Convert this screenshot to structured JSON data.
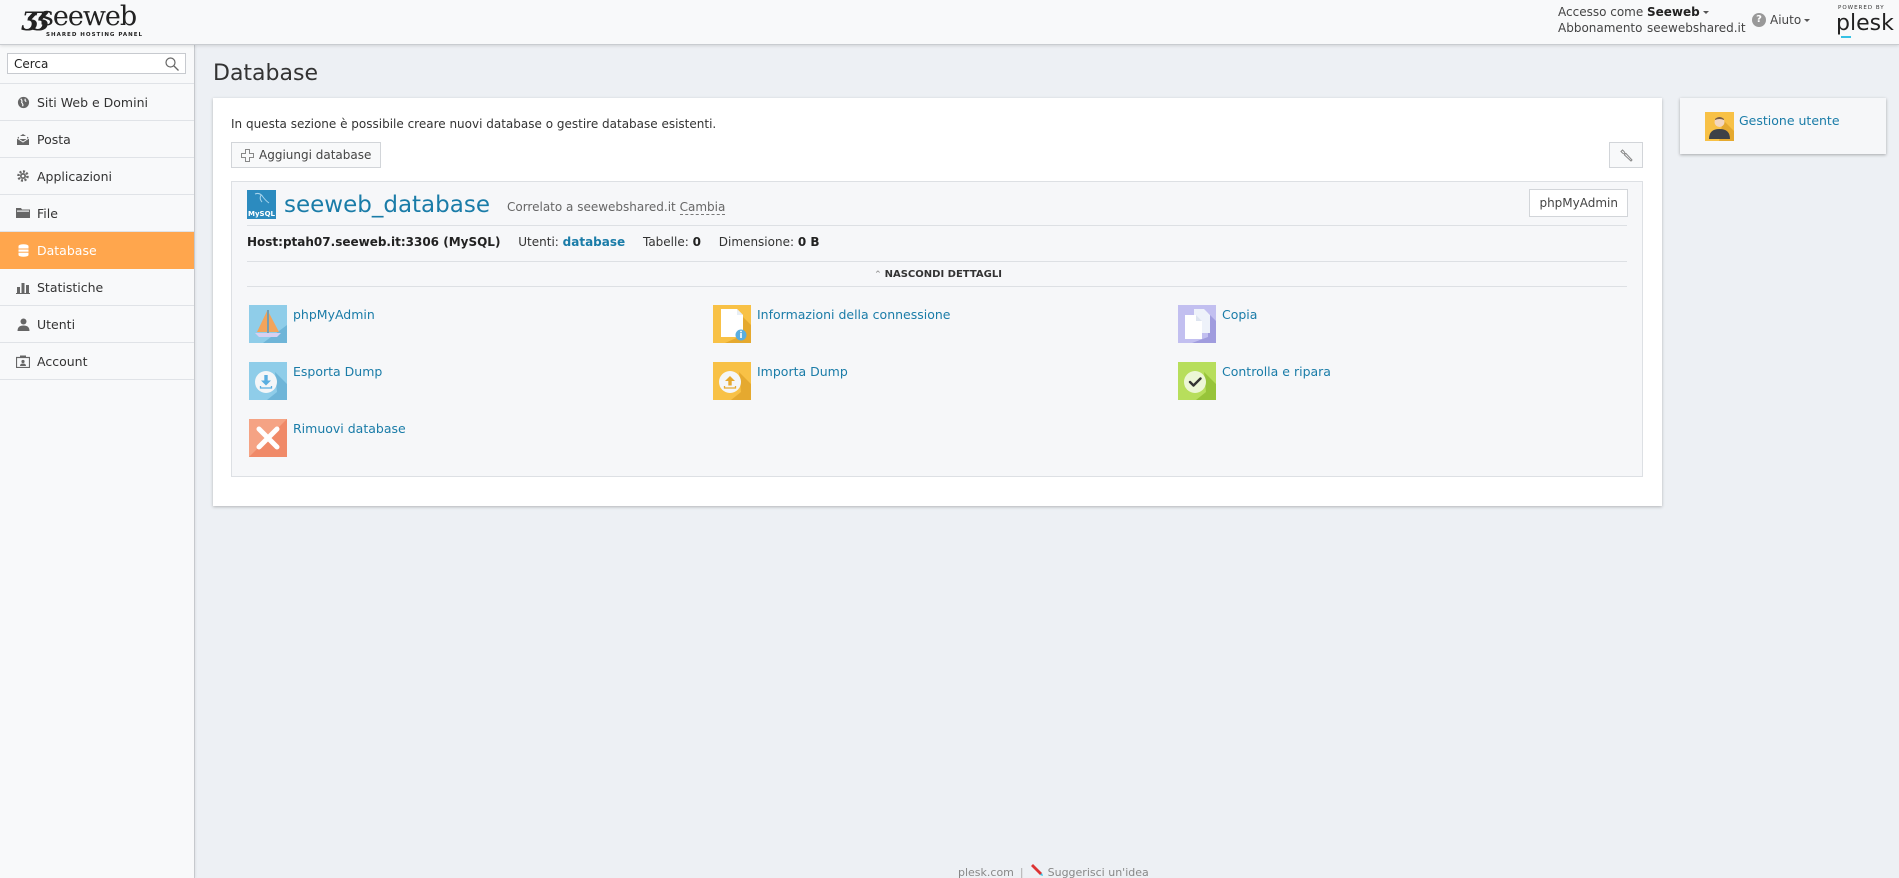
{
  "header": {
    "brand": "seeweb",
    "brand_sub": "SHARED HOSTING PANEL",
    "login_label": "Accesso come",
    "login_user": "Seeweb",
    "subscription_label": "Abbonamento",
    "subscription_value": "seewebshared.it",
    "help_label": "Aiuto",
    "powered_by": "POWERED BY",
    "plesk": "plesk"
  },
  "sidebar": {
    "search_placeholder": "Cerca",
    "search_value": "Cerca",
    "items": [
      {
        "label": "Siti Web e Domini",
        "icon": "globe-icon",
        "active": false
      },
      {
        "label": "Posta",
        "icon": "mail-icon",
        "active": false
      },
      {
        "label": "Applicazioni",
        "icon": "gear-icon",
        "active": false
      },
      {
        "label": "File",
        "icon": "folder-icon",
        "active": false
      },
      {
        "label": "Database",
        "icon": "database-icon",
        "active": true
      },
      {
        "label": "Statistiche",
        "icon": "bar-chart-icon",
        "active": false
      },
      {
        "label": "Utenti",
        "icon": "user-icon",
        "active": false
      },
      {
        "label": "Account",
        "icon": "account-icon",
        "active": false
      }
    ],
    "active_color": "#ffa64d"
  },
  "main": {
    "title": "Database",
    "intro": "In questa sezione è possibile creare nuovi database o gestire database esistenti.",
    "add_button": "Aggiungi database",
    "database": {
      "name": "seeweb_database",
      "type_badge": "MySQL",
      "related_prefix": "Correlato a seewebshared.it",
      "change_link": "Cambia",
      "phpmyadmin_button": "phpMyAdmin",
      "host": "Host:ptah07.seeweb.it:3306 (MySQL)",
      "users_label": "Utenti:",
      "users_value": "database",
      "tables_label": "Tabelle:",
      "tables_value": "0",
      "size_label": "Dimensione:",
      "size_value": "0 B",
      "toggle_details": "NASCONDI DETTAGLI",
      "tools": [
        {
          "label": "phpMyAdmin",
          "icon": "phpmyadmin-icon"
        },
        {
          "label": "Informazioni della connessione",
          "icon": "connection-info-icon"
        },
        {
          "label": "Copia",
          "icon": "copy-icon"
        },
        {
          "label": "Esporta Dump",
          "icon": "export-dump-icon"
        },
        {
          "label": "Importa Dump",
          "icon": "import-dump-icon"
        },
        {
          "label": "Controlla e ripara",
          "icon": "check-repair-icon"
        },
        {
          "label": "Rimuovi database",
          "icon": "remove-database-icon"
        }
      ]
    }
  },
  "side_panel": {
    "user_management": "Gestione utente"
  },
  "footer": {
    "plesk_link": "plesk.com",
    "suggest_link": "Suggerisci un'idea"
  }
}
